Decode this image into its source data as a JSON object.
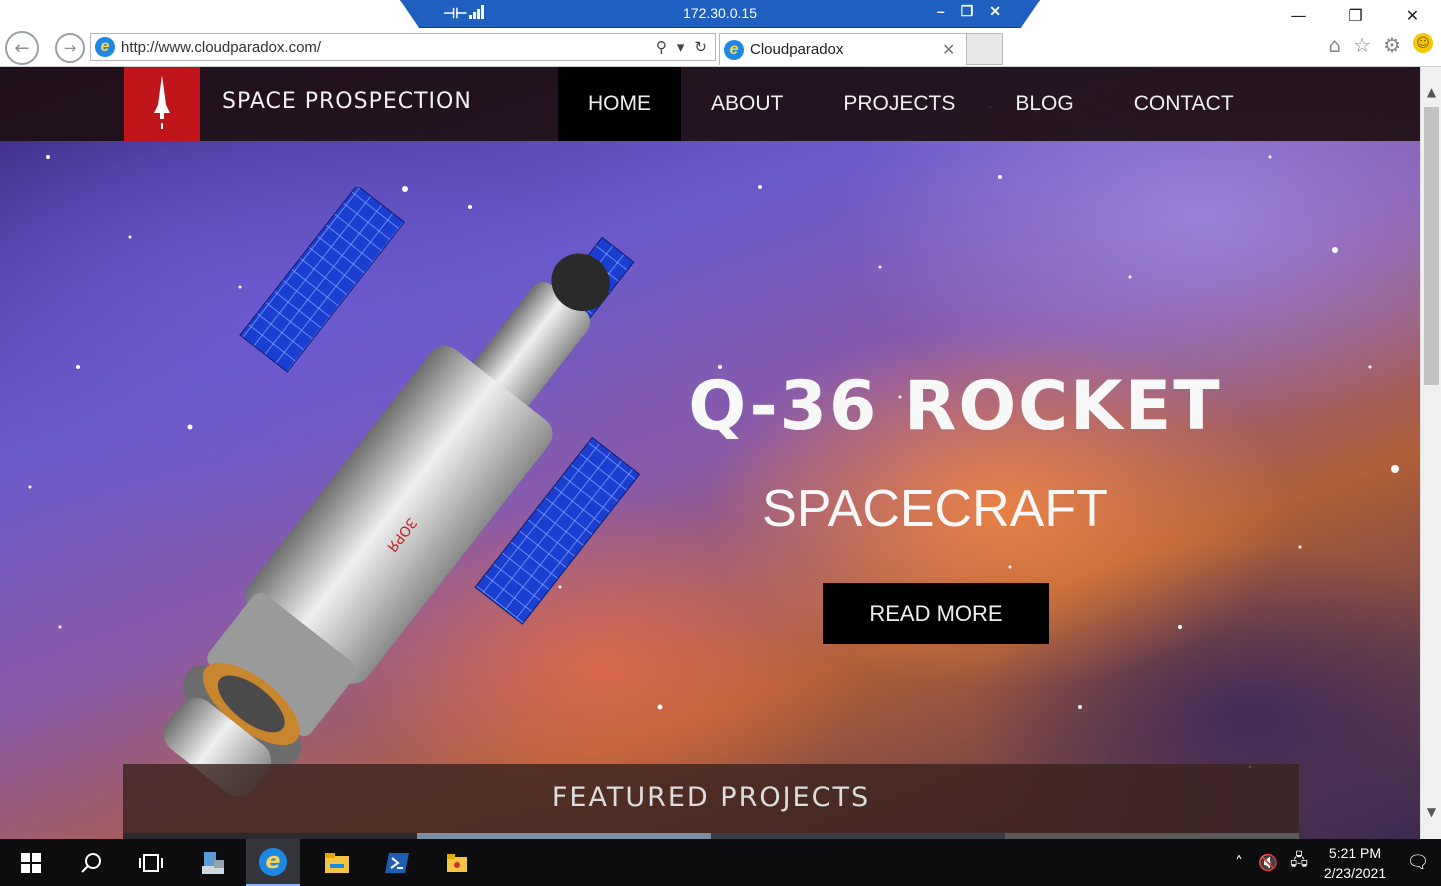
{
  "rdp": {
    "ip": "172.30.0.15"
  },
  "browser": {
    "url": "http://www.cloudparadox.com/",
    "tab_title": "Cloudparadox"
  },
  "site": {
    "brand": "SPACE PROSPECTION",
    "nav": [
      "HOME",
      "ABOUT",
      "PROJECTS",
      "BLOG",
      "CONTACT"
    ],
    "active_nav": "HOME",
    "hero_title": "Q-36 ROCKET",
    "hero_subtitle": "SPACECRAFT",
    "cta_label": "READ MORE",
    "featured_heading": "FEATURED PROJECTS"
  },
  "taskbar": {
    "time": "5:21 PM",
    "date": "2/23/2021"
  },
  "colors": {
    "brand_red": "#c0151a",
    "nav_bg": "#1e0e12",
    "rdp_blue": "#1f5fbf"
  },
  "icons": [
    "windows-start-icon",
    "search-icon",
    "task-view-icon",
    "server-manager-icon",
    "internet-explorer-icon",
    "file-explorer-icon",
    "powershell-icon",
    "app-icon"
  ]
}
